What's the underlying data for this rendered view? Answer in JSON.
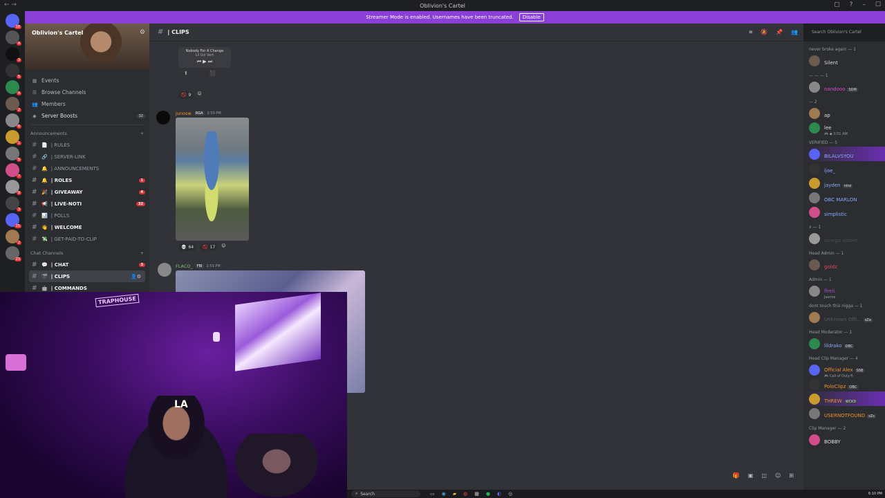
{
  "window": {
    "title": "Oblivion's Cartel"
  },
  "banner": {
    "text": "Streamer Mode is enabled. Usernames have been truncated.",
    "button": "Disable"
  },
  "server": {
    "name": "Oblivion's Cartel",
    "nav": [
      {
        "icon": "calendar-icon",
        "label": "Events"
      },
      {
        "icon": "browse-icon",
        "label": "Browse Channels"
      },
      {
        "icon": "members-icon",
        "label": "Members"
      },
      {
        "icon": "boost-icon",
        "label": "Server Boosts",
        "count": "32"
      }
    ],
    "categories": [
      {
        "label": "Announcements",
        "channels": [
          {
            "emoji": "📄",
            "label": "| RULES",
            "bold": false
          },
          {
            "emoji": "🔗",
            "label": "| SERVER-LINK",
            "bold": false
          },
          {
            "emoji": "🔔",
            "label": "| ANNOUNCEMENTS",
            "bold": false
          },
          {
            "emoji": "🔔",
            "label": "| ROLES",
            "bold": true,
            "badge": "1"
          },
          {
            "emoji": "🎉",
            "label": "| GIVEAWAY",
            "bold": true,
            "badge": "4"
          },
          {
            "emoji": "📢",
            "label": "| LIVE-NOTI",
            "bold": true,
            "badge": "32"
          },
          {
            "emoji": "📊",
            "label": "| POLLS",
            "bold": false
          },
          {
            "emoji": "👋",
            "label": "| WELCOME",
            "bold": true
          },
          {
            "emoji": "💸",
            "label": "| GET-PAID-TO-CLIP",
            "bold": false
          }
        ]
      },
      {
        "label": "Chat Channels",
        "channels": [
          {
            "emoji": "💬",
            "label": "| CHAT",
            "bold": true,
            "badge": "3"
          },
          {
            "emoji": "🎬",
            "label": "| CLIPS",
            "bold": true,
            "active": true
          },
          {
            "emoji": "🤖",
            "label": "| COMMANDS",
            "bold": true
          }
        ]
      }
    ]
  },
  "chat": {
    "channel": "| CLIPS",
    "search_placeholder": "Search Oblivion's Cartel",
    "player": {
      "line1": "Nobody For A Change",
      "line2": "Lil Uzi Vert"
    },
    "reactions1": [
      {
        "emoji": "🚫",
        "count": "9"
      }
    ],
    "msg1": {
      "author": "junosw",
      "tag": "RGA",
      "time": "2:59 PM"
    },
    "reactions2": [
      {
        "emoji": "💀",
        "count": "64"
      },
      {
        "emoji": "🚫",
        "count": "17"
      }
    ],
    "msg2": {
      "author": "FLACO_",
      "tag": "FBI",
      "time": "2:59 PM"
    }
  },
  "members": {
    "groups": [
      {
        "label": "never broke again — 1",
        "items": [
          {
            "name": "Silent",
            "color": "#dbdee1",
            "tag": ""
          }
        ]
      },
      {
        "label": "— — — 1",
        "items": [
          {
            "name": "nandooo",
            "color": "#e04bd5",
            "tag": "SDM"
          }
        ]
      },
      {
        "label": "— 2",
        "items": [
          {
            "name": "ap",
            "color": "#dbdee1",
            "tag": ""
          },
          {
            "name": "lee",
            "color": "#dbdee1",
            "tag": "",
            "sub": "🎮 ◆ 3:51 AM"
          }
        ]
      },
      {
        "label": "VERIFIED — 5",
        "items": [
          {
            "name": "BILALVSYOU",
            "color": "#8aa8ff",
            "tag": "",
            "highlight": true
          },
          {
            "name": "ijae_",
            "color": "#8aa8ff",
            "tag": ""
          },
          {
            "name": "jayden",
            "color": "#8aa8ff",
            "tag": "nine"
          },
          {
            "name": "OBC MARLON",
            "color": "#8aa8ff",
            "tag": ""
          },
          {
            "name": "simplistic",
            "color": "#8aa8ff",
            "tag": ""
          }
        ]
      },
      {
        "label": "x — 1",
        "items": [
          {
            "name": "omega sorbet",
            "color": "#4b4e55",
            "tag": ""
          }
        ]
      },
      {
        "label": "Head Admin — 1",
        "items": [
          {
            "name": "goldz",
            "color": "#e04b6a",
            "tag": ""
          }
        ]
      },
      {
        "label": "Admin — 1",
        "items": [
          {
            "name": "fireli",
            "color": "#b04bd5",
            "tag": "",
            "sub": "Jasmie"
          }
        ]
      },
      {
        "label": "dont touch this nigga — 1",
        "items": [
          {
            "name": "Unknown Offi...",
            "color": "#555960",
            "tag": "sZa"
          }
        ]
      },
      {
        "label": "Head Moderator — 1",
        "items": [
          {
            "name": "lildrako",
            "color": "#8aa8ff",
            "tag": "OBC"
          }
        ]
      },
      {
        "label": "Head Clip Manager — 4",
        "items": [
          {
            "name": "Official Alex",
            "color": "#f0932b",
            "tag": "SSB",
            "sub": "🎮 Call of Duty®"
          },
          {
            "name": "PoloClipz",
            "color": "#f0932b",
            "tag": "OBC"
          },
          {
            "name": "THREW",
            "color": "#f0932b",
            "tag": "WCKD",
            "highlight": true
          },
          {
            "name": "USERNOTFOUND",
            "color": "#f0932b",
            "tag": "sZs"
          }
        ]
      },
      {
        "label": "Clip Manager — 2",
        "items": [
          {
            "name": "BOBBY",
            "color": "#dbdee1",
            "tag": ""
          }
        ]
      }
    ]
  },
  "taskbar": {
    "search": "Search",
    "clock": "6:10 PM"
  }
}
